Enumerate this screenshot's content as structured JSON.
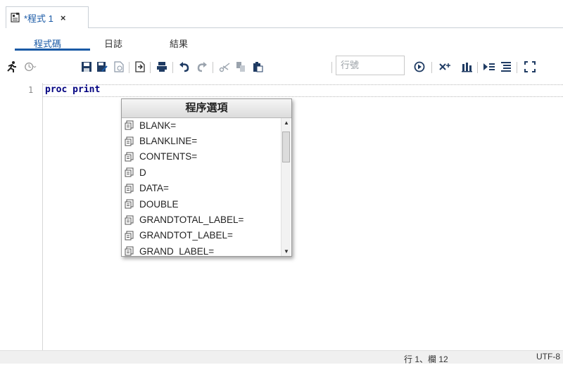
{
  "tab": {
    "title": "*程式 1",
    "close": "×",
    "icon": "program-file-icon"
  },
  "subtabs": [
    {
      "label": "程式碼",
      "active": true
    },
    {
      "label": "日誌",
      "active": false
    },
    {
      "label": "結果",
      "active": false
    }
  ],
  "toolbar": {
    "line_placeholder": "行號",
    "icons": [
      "run-icon",
      "history-icon",
      "save-icon",
      "save-as-icon",
      "open-recent-icon",
      "export-icon",
      "print-icon",
      "undo-icon",
      "redo-icon",
      "cut-icon",
      "copy-icon",
      "paste-icon",
      "go-to-line-icon",
      "clear-icon",
      "format-icon",
      "submit-selection-icon",
      "outline-icon",
      "maximize-icon"
    ]
  },
  "editor": {
    "line_number": "1",
    "code": "proc print"
  },
  "popup": {
    "title": "程序選項",
    "items": [
      "BLANK=",
      "BLANKLINE=",
      "CONTENTS=",
      "D",
      "DATA=",
      "DOUBLE",
      "GRANDTOTAL_LABEL=",
      "GRANDTOT_LABEL=",
      "GRAND_LABEL="
    ]
  },
  "status": {
    "position": "行 1、欄 12",
    "encoding": "UTF-8"
  },
  "colors": {
    "accent": "#1a5aa6",
    "code_keyword": "#000080"
  }
}
